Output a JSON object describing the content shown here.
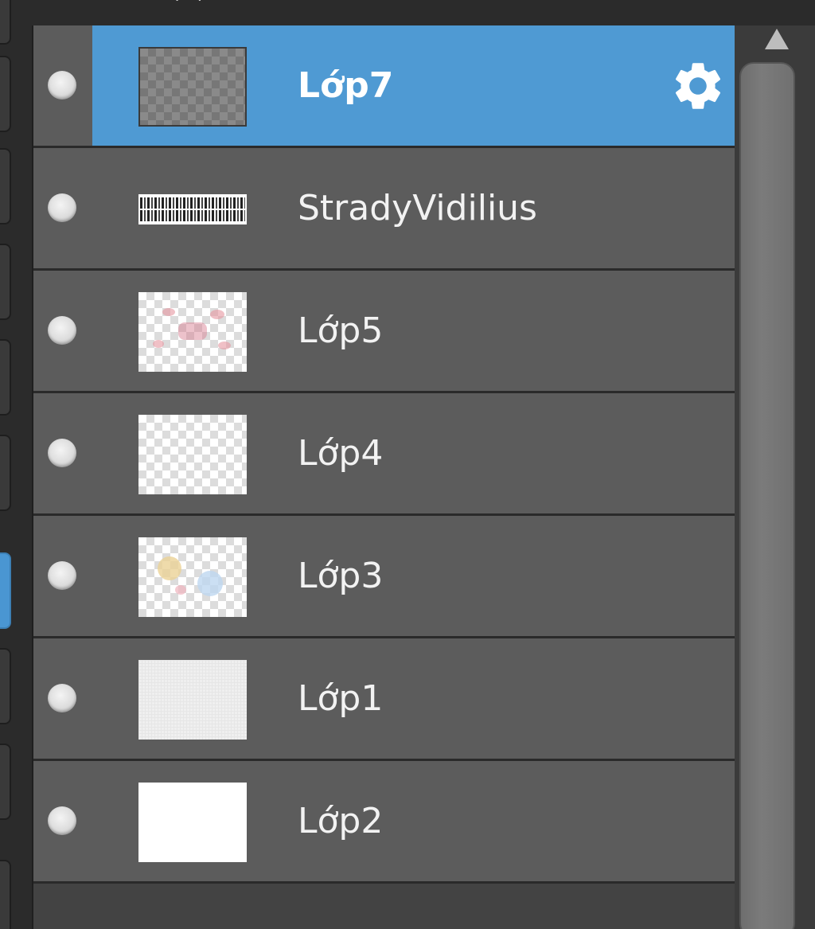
{
  "top_fragment": "‥·¸·",
  "layers": [
    {
      "name": "Lớp7",
      "selected": true,
      "thumb": "dark-checker",
      "icon": "gear-icon"
    },
    {
      "name": "StradyVidilius",
      "selected": false,
      "thumb": "text"
    },
    {
      "name": "Lớp5",
      "selected": false,
      "thumb": "checker-pink"
    },
    {
      "name": "Lớp4",
      "selected": false,
      "thumb": "checker"
    },
    {
      "name": "Lớp3",
      "selected": false,
      "thumb": "checker-dots"
    },
    {
      "name": "Lớp1",
      "selected": false,
      "thumb": "light-grey"
    },
    {
      "name": "Lớp2",
      "selected": false,
      "thumb": "white"
    }
  ],
  "colors": {
    "selected": "#4f9ad3",
    "row": "#5c5c5c",
    "panel": "#434343",
    "background": "#2b2b2b"
  },
  "scrollbar": {
    "up_icon": "triangle-up-icon"
  }
}
